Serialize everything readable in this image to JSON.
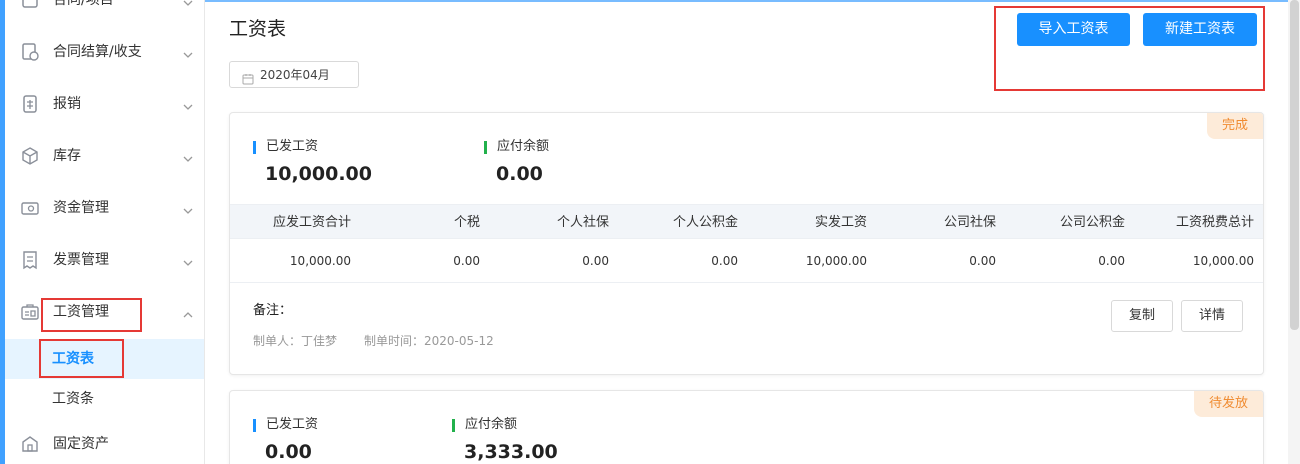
{
  "sidebar": {
    "items": [
      {
        "label": "合同/项目",
        "icon": "contract-icon"
      },
      {
        "label": "合同结算/收支",
        "icon": "settlement-icon"
      },
      {
        "label": "报销",
        "icon": "reimburse-icon"
      },
      {
        "label": "库存",
        "icon": "inventory-icon"
      },
      {
        "label": "资金管理",
        "icon": "fund-icon"
      },
      {
        "label": "发票管理",
        "icon": "invoice-icon"
      },
      {
        "label": "工资管理",
        "icon": "salary-icon"
      },
      {
        "label": "固定资产",
        "icon": "asset-icon"
      }
    ],
    "sub_items": [
      {
        "label": "工资表",
        "active": true
      },
      {
        "label": "工资条",
        "active": false
      }
    ]
  },
  "header": {
    "title": "工资表",
    "date_value": "2020年04月",
    "import_label": "导入工资表",
    "new_label": "新建工资表"
  },
  "colors": {
    "accent": "#1890ff",
    "highlight_box": "#e53935",
    "paid_bar": "#1890ff",
    "due_bar": "#22b14c",
    "badge_bg": "#fdebd9",
    "badge_text": "#f08c32"
  },
  "cards": [
    {
      "status": "完成",
      "paid_label": "已发工资",
      "paid_value": "10,000.00",
      "due_label": "应付余额",
      "due_value": "0.00",
      "columns": [
        "应发工资合计",
        "个税",
        "个人社保",
        "个人公积金",
        "实发工资",
        "公司社保",
        "公司公积金",
        "工资税费总计"
      ],
      "values": [
        "10,000.00",
        "0.00",
        "0.00",
        "0.00",
        "10,000.00",
        "0.00",
        "0.00",
        "10,000.00"
      ],
      "remark_label": "备注：",
      "creator": "制单人：丁佳梦",
      "created_time": "制单时间：2020-05-12",
      "copy_label": "复制",
      "detail_label": "详情"
    },
    {
      "status": "待发放",
      "paid_label": "已发工资",
      "paid_value": "0.00",
      "due_label": "应付余额",
      "due_value": "3,333.00"
    }
  ]
}
